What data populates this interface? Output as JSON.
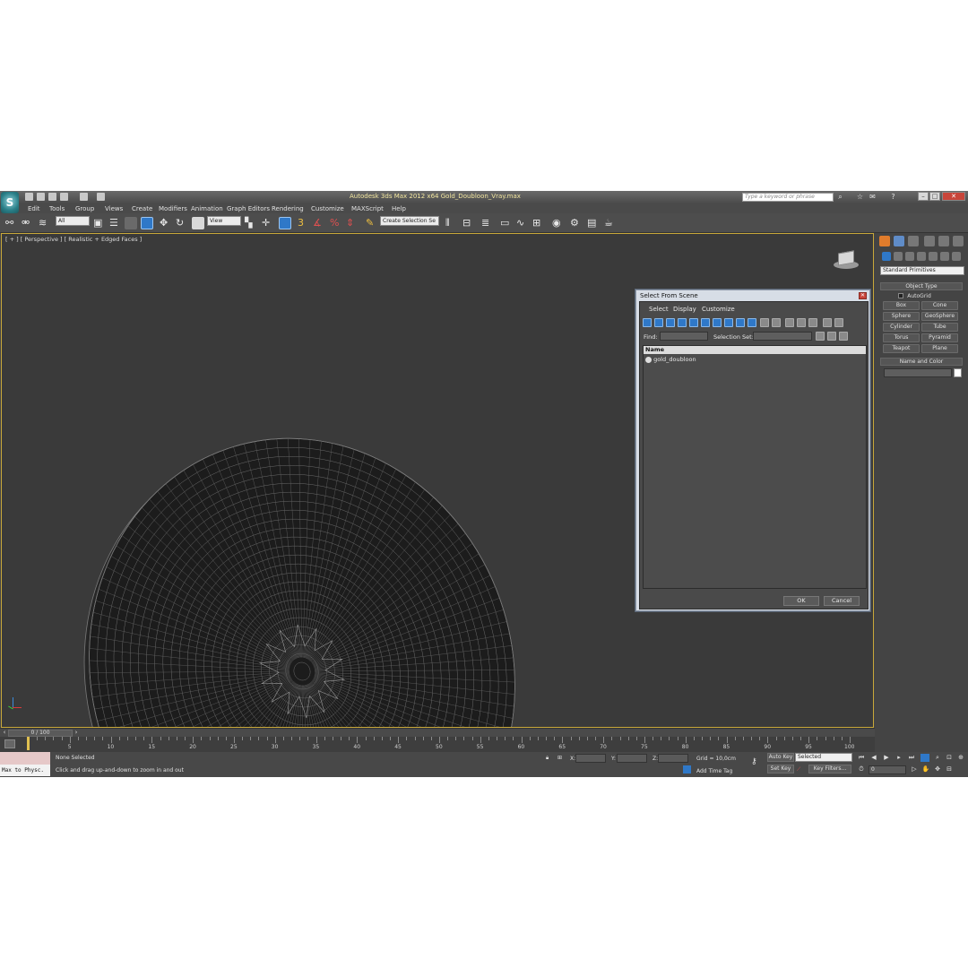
{
  "window": {
    "title": "Autodesk 3ds Max 2012 x64     Gold_Doubloon_Vray.max",
    "search_placeholder": "Type a keyword or phrase",
    "logo_letter": "S"
  },
  "menu": [
    "Edit",
    "Tools",
    "Group",
    "Views",
    "Create",
    "Modifiers",
    "Animation",
    "Graph Editors",
    "Rendering",
    "Customize",
    "MAXScript",
    "Help"
  ],
  "toolbar": {
    "selection_filter": "All",
    "reference_coord": "View",
    "snap_label": "3",
    "named_selection": "Create Selection Se"
  },
  "viewport": {
    "label": "[ + ] [ Perspective ] [ Realistic + Edged Faces ]"
  },
  "command_panel": {
    "category": "Standard Primitives",
    "object_type_title": "Object Type",
    "autogrid_label": "AutoGrid",
    "buttons": [
      "Box",
      "Cone",
      "Sphere",
      "GeoSphere",
      "Cylinder",
      "Tube",
      "Torus",
      "Pyramid",
      "Teapot",
      "Plane"
    ],
    "name_color_title": "Name and Color"
  },
  "dialog": {
    "title": "Select From Scene",
    "menu": [
      "Select",
      "Display",
      "Customize"
    ],
    "find_label": "Find:",
    "selection_set_label": "Selection Set:",
    "column_header": "Name",
    "rows": [
      "gold_doubloon"
    ],
    "ok_label": "OK",
    "cancel_label": "Cancel"
  },
  "timeline": {
    "frame_readout": "0 / 100",
    "ticks": [
      "5",
      "10",
      "15",
      "20",
      "25",
      "30",
      "35",
      "40",
      "45",
      "50",
      "55",
      "60",
      "65",
      "70",
      "75",
      "80",
      "85",
      "90",
      "95",
      "100"
    ]
  },
  "status": {
    "maxscript_listener": "Max to Physc.",
    "selection": "None Selected",
    "prompt": "Click and drag up-and-down to zoom in and out",
    "x_label": "X:",
    "y_label": "Y:",
    "z_label": "Z:",
    "grid": "Grid = 10,0cm",
    "add_time_tag": "Add Time Tag",
    "auto_key": "Auto Key",
    "set_key": "Set Key",
    "key_mode": "Selected",
    "key_filters": "Key Filters...",
    "current_frame": "0"
  },
  "colors": {
    "viewport_border": "#c8a83a",
    "active_tool": "#2f78c8",
    "window_title_text": "#f2e6a0"
  }
}
